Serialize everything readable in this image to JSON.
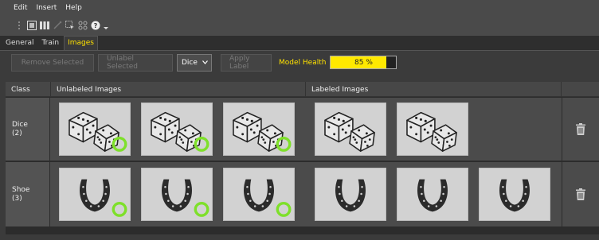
{
  "menu": [
    "Edit",
    "Insert",
    "Help"
  ],
  "toolbar": {
    "icons": [
      "grip-icon",
      "image-icon",
      "columns-icon",
      "magic-icon",
      "select-icon",
      "grid-icon",
      "help-icon",
      "dropdown-arrow-icon"
    ]
  },
  "tabs": [
    {
      "label": "General",
      "active": false
    },
    {
      "label": "Train",
      "active": false
    },
    {
      "label": "Images",
      "active": true
    }
  ],
  "actions": {
    "remove_selected": "Remove Selected",
    "unlabel_selected": "Unlabel Selected",
    "class_select": "Dice",
    "apply_label": "Apply Label",
    "model_health_label": "Model Health",
    "model_health_value": "85 %",
    "model_health_fraction": 0.85
  },
  "table": {
    "headers": {
      "class": "Class",
      "unlabeled": "Unlabeled Images",
      "labeled": "Labeled Images"
    },
    "rows": [
      {
        "class_name": "Dice",
        "count": "(2)",
        "unlabeled": [
          {
            "subject": "dice",
            "marker": "green-ring"
          },
          {
            "subject": "dice",
            "marker": "green-ring"
          },
          {
            "subject": "dice",
            "marker": "green-ring"
          }
        ],
        "labeled": [
          {
            "subject": "dice"
          },
          {
            "subject": "dice"
          }
        ]
      },
      {
        "class_name": "Shoe",
        "count": "(3)",
        "unlabeled": [
          {
            "subject": "horseshoe",
            "marker": "green-ring"
          },
          {
            "subject": "horseshoe",
            "marker": "green-ring"
          },
          {
            "subject": "horseshoe",
            "marker": "green-ring"
          }
        ],
        "labeled": [
          {
            "subject": "horseshoe"
          },
          {
            "subject": "horseshoe"
          },
          {
            "subject": "horseshoe"
          }
        ]
      }
    ]
  },
  "colors": {
    "accent": "#ffe200",
    "health_fill": "#ffe900",
    "ring": "#7ee02a"
  }
}
